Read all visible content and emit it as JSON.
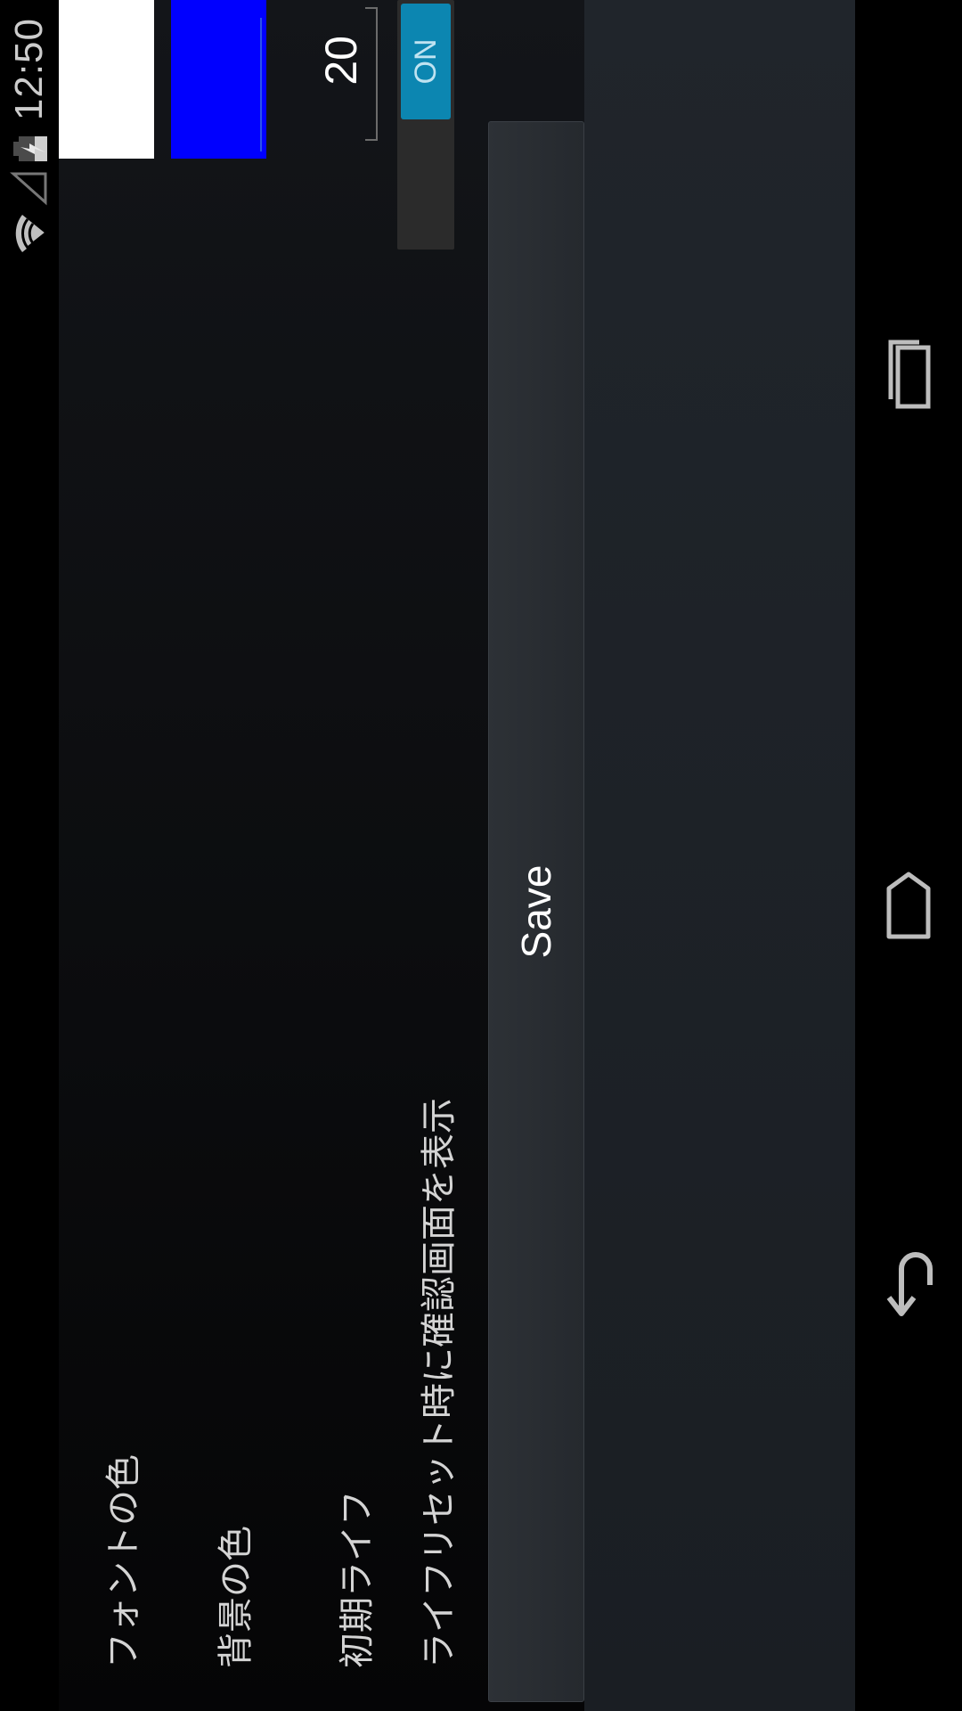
{
  "status_bar": {
    "time": "12:50",
    "icons": [
      "wifi-icon",
      "signal-icon",
      "battery-charging-icon"
    ]
  },
  "settings": {
    "font_color": {
      "label": "フォントの色",
      "color": "#FFFFFF"
    },
    "background_color": {
      "label": "背景の色",
      "color": "#0000FF"
    },
    "initial_life": {
      "label": "初期ライフ",
      "value": "20"
    },
    "confirm_on_reset": {
      "label": "ライフリセット時に確認画面を表示",
      "toggle_text": "ON"
    }
  },
  "save_button": {
    "label": "Save"
  },
  "nav_bar": {
    "icons": [
      "back-icon",
      "home-icon",
      "recent-apps-icon"
    ]
  },
  "theme": {
    "toggle_on_color": "#0C86B1",
    "button_background": "#2B2F34"
  }
}
